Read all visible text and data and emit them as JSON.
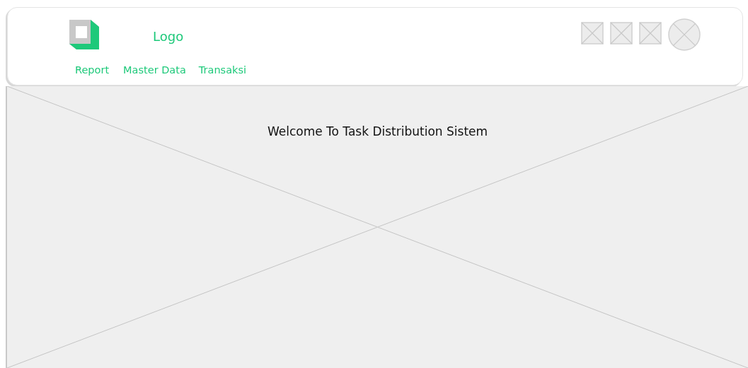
{
  "header": {
    "logo_text": "Logo",
    "nav": [
      "Report",
      "Master Data",
      "Transaksi"
    ]
  },
  "hero": {
    "title": "Welcome To Task Distribution Sistem"
  }
}
